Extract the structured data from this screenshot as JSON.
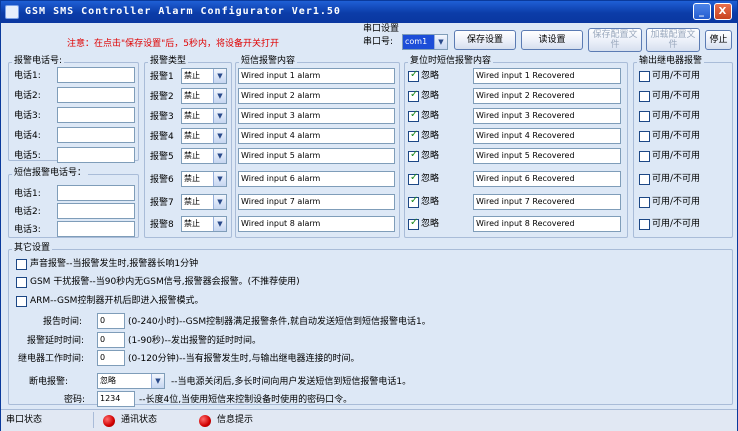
{
  "window": {
    "title": "GSM SMS Controller Alarm Configurator Ver1.50",
    "min": "_",
    "close": "X"
  },
  "warning": "注意：在点击\"保存设置\"后，5秒内，将设备开关打开",
  "port": {
    "group_title": "串口设置",
    "label": "串口号:",
    "value": "com1"
  },
  "buttons": {
    "save": "保存设置",
    "read": "读设置",
    "save_file": "保存配置文件",
    "load_file": "加载配置文件",
    "stop": "停止"
  },
  "alarm_phones": {
    "title": "报警电话号:",
    "labels": [
      "电话1:",
      "电话2:",
      "电话3:",
      "电话4:",
      "电话5:"
    ]
  },
  "sms_phones": {
    "title": "短信报警电话号：",
    "labels": [
      "电话1:",
      "电话2:",
      "电话3:"
    ]
  },
  "alarm_type": {
    "title": "报警类型",
    "labels": [
      "报警1",
      "报警2",
      "报警3",
      "报警4",
      "报警5",
      "报警6",
      "报警7",
      "报警8"
    ],
    "value": "禁止"
  },
  "sms_content": {
    "title": "短信报警内容",
    "items": [
      "Wired input 1 alarm",
      "Wired input 2 alarm",
      "Wired input 3 alarm",
      "Wired input 4 alarm",
      "Wired input 5 alarm",
      "Wired input 6 alarm",
      "Wired input 7 alarm",
      "Wired input 8 alarm"
    ]
  },
  "recovery": {
    "title": "复位时短信报警内容",
    "ignore_label": "忽略",
    "items": [
      "Wired input 1 Recovered",
      "Wired input 2 Recovered",
      "Wired input 3 Recovered",
      "Wired input 4 Recovered",
      "Wired input 5 Recovered",
      "Wired input 6 Recovered",
      "Wired input 7 Recovered",
      "Wired input 8 Recovered"
    ]
  },
  "relay": {
    "title": "输出继电器报警",
    "label": "可用/不可用"
  },
  "other": {
    "title": "其它设置",
    "opt_sound": "声音报警--当报警发生时,报警器长响1分钟",
    "opt_gsm": "GSM 干扰报警--当90秒内无GSM信号,报警器会报警。(不推荐使用)",
    "opt_arm": "ARM--GSM控制器开机后即进入报警模式。",
    "report_label": "报告时间:",
    "report_value": "0",
    "report_desc": "(0-240小时)--GSM控制器满足报警条件,就自动发送短信到短信报警电话1。",
    "delay_label": "报警延时时间:",
    "delay_value": "0",
    "delay_desc": "(1-90秒)--发出报警的延时时间。",
    "relay_time_label": "继电器工作时间:",
    "relay_time_value": "0",
    "relay_time_desc": "(0-120分钟)--当有报警发生时,与输出继电器连接的时间。",
    "power_label": "断电报警:",
    "power_value": "忽略",
    "power_desc": "--当电源关闭后,多长时间向用户发送短信到短信报警电话1。",
    "pwd_label": "密码:",
    "pwd_value": "1234",
    "pwd_desc": "--长度4位,当使用短信来控制设备时使用的密码口令。"
  },
  "status": {
    "port": "串口状态",
    "comm": "通讯状态",
    "info": "信息提示"
  },
  "colors": {
    "titlebar": "#0b3ca8",
    "warning": "#e00000",
    "led": "#d00000"
  }
}
